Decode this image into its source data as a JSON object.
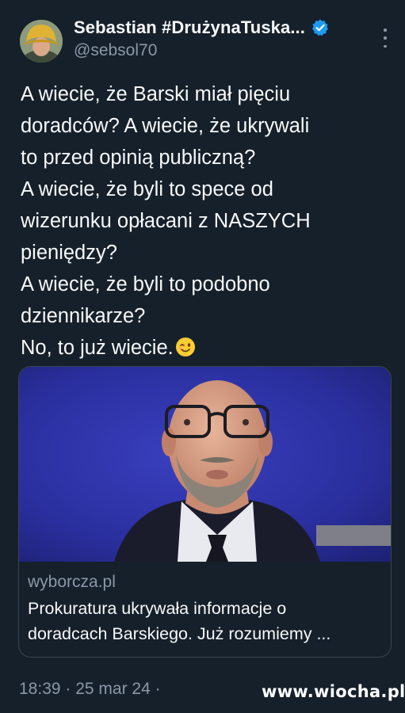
{
  "author": {
    "display_name": "Sebastian #DrużynaTuska...",
    "handle": "@sebsol70",
    "verified_icon": "verified-badge-icon",
    "avatar_icon": "avatar-icon"
  },
  "menu": {
    "more_icon": "more-vertical-icon"
  },
  "tweet": {
    "lines": [
      "A wiecie, że Barski miał pięciu",
      "doradców? A wiecie, że ukrywali",
      "to przed opinią publiczną?",
      "A wiecie, że byli to spece od",
      "wizerunku opłacani z NASZYCH",
      "pieniędzy?",
      "A wiecie, że byli to podobno",
      "dziennikarze?",
      "No, to już wiecie."
    ],
    "emoji": "winking-face-emoji"
  },
  "card": {
    "domain": "wyborcza.pl",
    "title_lines": [
      "Prokuratura ukrywała informacje o",
      "doradcach Barskiego. Już rozumiemy ..."
    ]
  },
  "footer": {
    "timestamp": "18:39 · 25 mar 24 ·"
  },
  "watermark": "www.wiocha.pl",
  "colors": {
    "background": "#15202b",
    "text": "#f7f9f9",
    "secondary_text": "#8b98a5",
    "verified_blue": "#1d9bf0",
    "border": "#38444d"
  }
}
